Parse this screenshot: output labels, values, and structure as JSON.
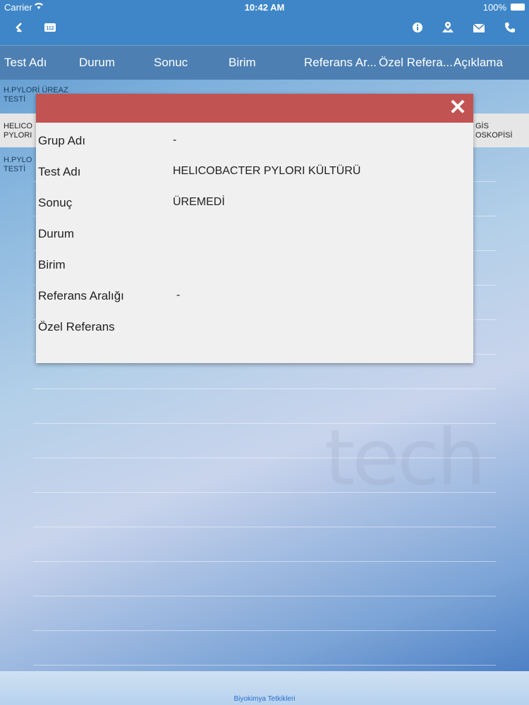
{
  "status_bar": {
    "carrier": "Carrier",
    "time": "10:42 AM",
    "battery": "100%"
  },
  "nav": {
    "icons": [
      "back-chevron-icon",
      "emergency-112-icon",
      "info-icon",
      "map-location-icon",
      "mail-icon",
      "phone-icon"
    ],
    "badge_112": "112"
  },
  "table": {
    "headers": [
      "Test Adı",
      "Durum",
      "Sonuc",
      "Birim",
      "Referans Ar...",
      "Özel Refera...",
      "Açıklama"
    ],
    "rows": [
      {
        "line1": "H.PYLORİ ÜREAZ",
        "line2": "TESTİ",
        "right1": "",
        "right2": ""
      },
      {
        "line1": "HELICO",
        "line2": "PYLORI",
        "right1": "GİS",
        "right2": "OSKOPİSİ"
      },
      {
        "line1": "H.PYLO",
        "line2": "TESTİ",
        "right1": "",
        "right2": ""
      }
    ]
  },
  "modal": {
    "header_color": "#c25353",
    "close_icon": "close-icon",
    "fields": [
      {
        "label": "Grup Adı",
        "value": "-"
      },
      {
        "label": "Test Adı",
        "value": "HELICOBACTER PYLORI KÜLTÜRÜ"
      },
      {
        "label": "Sonuç",
        "value": "ÜREMEDİ"
      },
      {
        "label": "Durum",
        "value": ""
      },
      {
        "label": "Birim",
        "value": ""
      },
      {
        "label": "Referans Aralığı",
        "value": "-"
      },
      {
        "label": "Özel Referans",
        "value": ""
      }
    ]
  },
  "watermark": "tech",
  "footer": {
    "tab_label": "Biyokimya Tetkikleri"
  },
  "colors": {
    "nav": "#3f86c8",
    "table_header": "#4d7fb3"
  }
}
